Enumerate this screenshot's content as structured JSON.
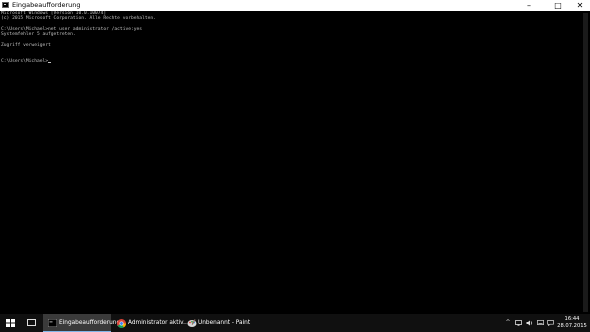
{
  "window": {
    "title": "Eingabeaufforderung",
    "controls": {
      "minimize": "–",
      "maximize": "□",
      "close": "✕"
    }
  },
  "console": {
    "lines": [
      "Microsoft Windows [Version 10.0.10074]",
      "(c) 2015 Microsoft Corporation. Alle Rechte vorbehalten.",
      "",
      "C:\\Users\\Michael>net user administrator /active:yes",
      "Systemfehler 5 aufgetreten.",
      "",
      "Zugriff verweigert",
      "",
      "",
      "C:\\Users\\Michael>"
    ]
  },
  "taskbar": {
    "apps": [
      {
        "label": "Eingabeaufforderung",
        "icon": "cmd-icon",
        "active": true
      },
      {
        "label": "Administrator aktiv...",
        "icon": "chrome-icon",
        "active": false
      },
      {
        "label": "Unbenannt - Paint",
        "icon": "paint-icon",
        "active": false
      }
    ],
    "tray": {
      "chevron": "^",
      "icons": [
        "network-icon",
        "volume-icon",
        "keyboard-icon",
        "notification-icon"
      ],
      "time": "16:44",
      "date": "28.07.2015"
    }
  },
  "colors": {
    "console_bg": "#000000",
    "console_text": "#c0c0c0",
    "taskbar_bg": "#101010",
    "accent": "#7fb6e8"
  }
}
